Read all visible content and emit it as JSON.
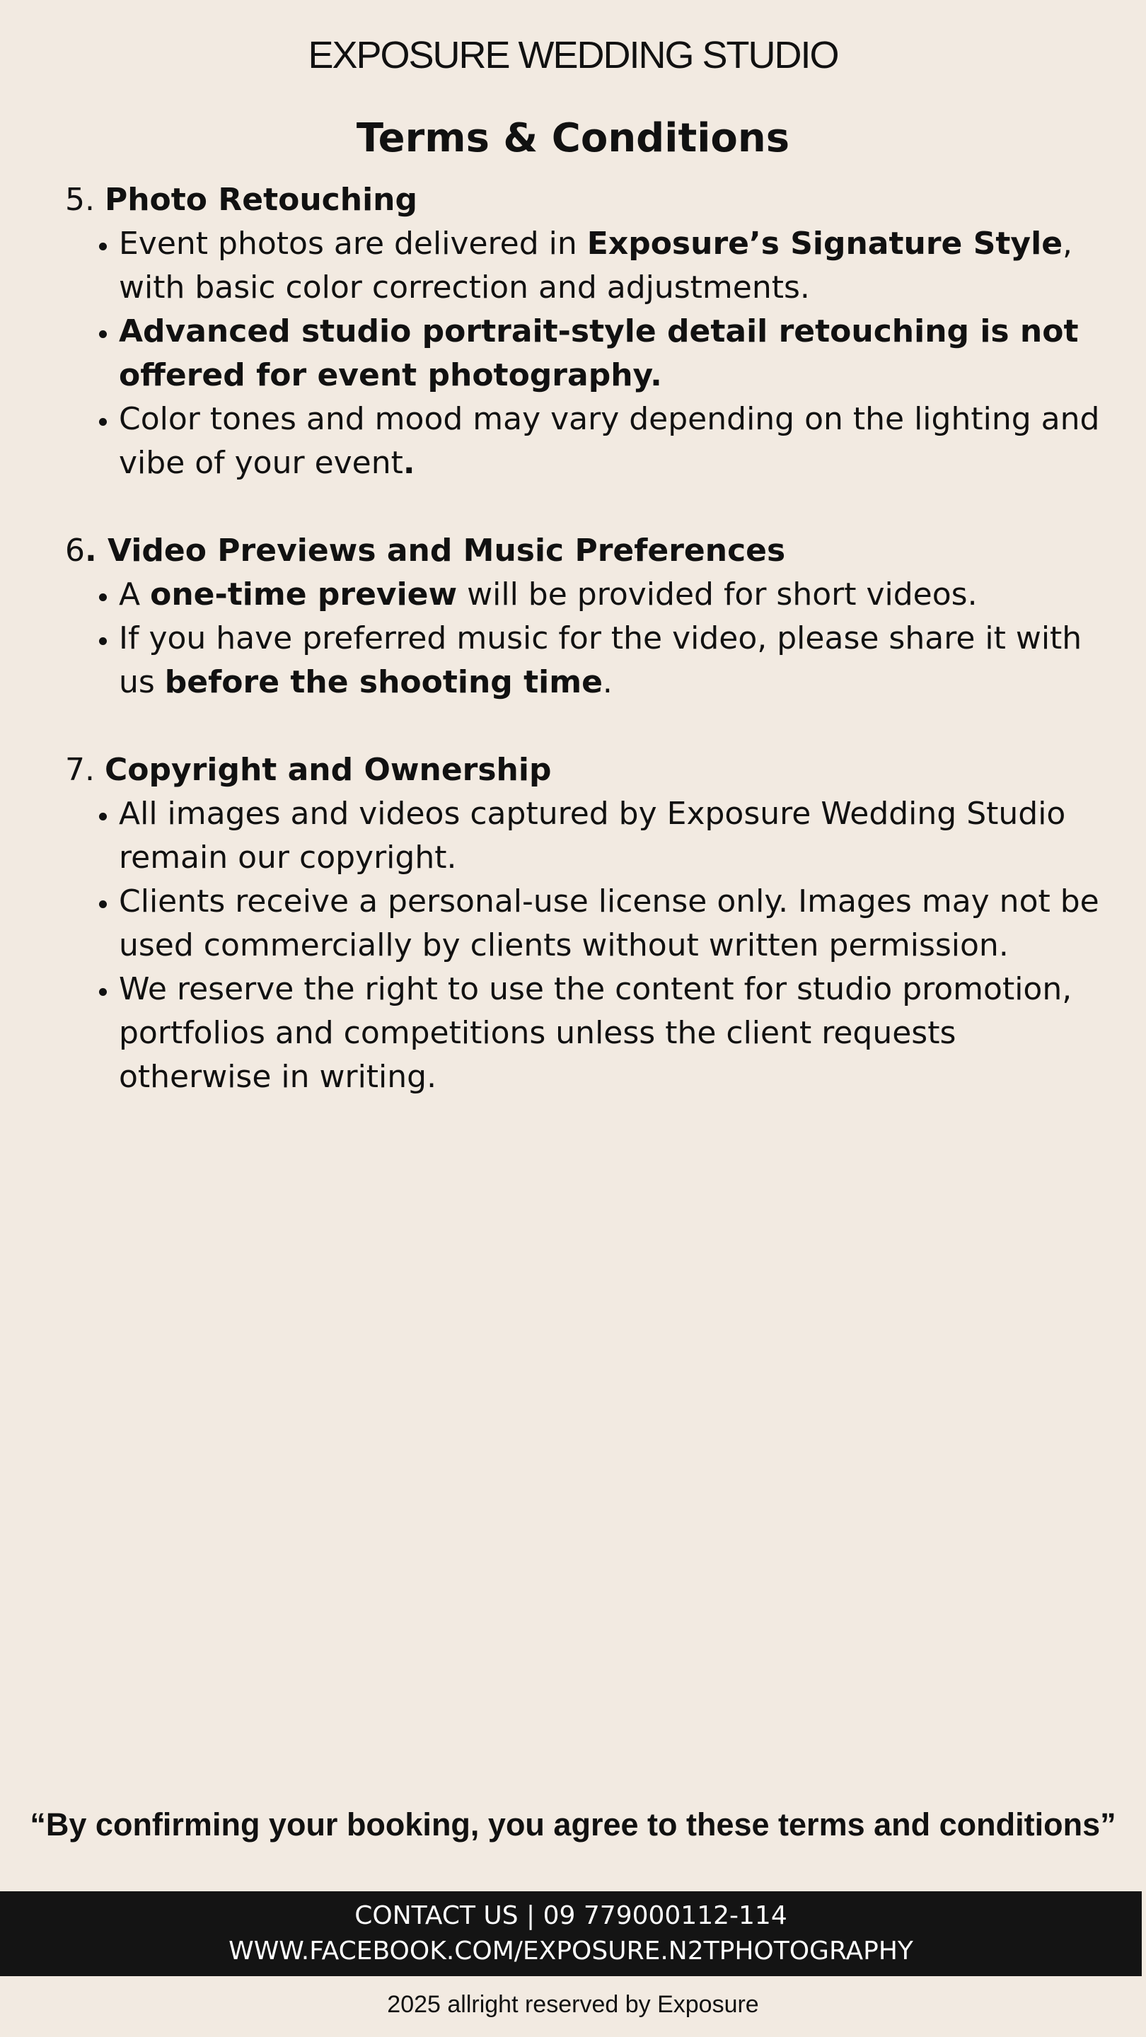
{
  "brand": "EXPOSURE WEDDING STUDIO",
  "title": "Terms & Conditions",
  "sections": [
    {
      "number": "5. ",
      "heading": "Photo Retouching",
      "bullets": [
        {
          "parts": [
            {
              "t": "Event photos are delivered in ",
              "b": false
            },
            {
              "t": "Exposure’s Signature Style",
              "b": true
            },
            {
              "t": ", with basic color correction and adjustments.",
              "b": false
            }
          ]
        },
        {
          "parts": [
            {
              "t": "Advanced  studio portrait-style detail retouching is not offered for event photography.",
              "b": true
            }
          ]
        },
        {
          "parts": [
            {
              "t": "Color tones and mood may vary depending on the lighting and vibe of your event",
              "b": false
            },
            {
              "t": ".",
              "b": true
            }
          ]
        }
      ]
    },
    {
      "number": "6",
      "heading": ". Video Previews and Music Preferences",
      "bullets": [
        {
          "parts": [
            {
              "t": "A ",
              "b": false
            },
            {
              "t": "one-time preview",
              "b": true
            },
            {
              "t": " will be provided for short videos.",
              "b": false
            }
          ]
        },
        {
          "parts": [
            {
              "t": "If you have preferred music for the video, please share it with us ",
              "b": false
            },
            {
              "t": "before the shooting time",
              "b": true
            },
            {
              "t": ".",
              "b": false
            }
          ]
        }
      ]
    },
    {
      "number": "7. ",
      "heading": "Copyright and Ownership",
      "bullets": [
        {
          "parts": [
            {
              "t": "All images and videos captured by Exposure Wedding Studio remain our copyright.",
              "b": false
            }
          ]
        },
        {
          "parts": [
            {
              "t": "Clients receive a personal-use license only. Images may not be used commercially by clients without written permission.",
              "b": false
            }
          ]
        },
        {
          "parts": [
            {
              "t": "We reserve the right to use the content for studio promotion, portfolios and competitions unless the client requests otherwise in writing.",
              "b": false
            }
          ]
        }
      ]
    }
  ],
  "quote": "“By confirming your booking, you agree to these terms and conditions”",
  "contact": {
    "line1": "CONTACT US | 09 779000112-114",
    "line2": "WWW.FACEBOOK.COM/EXPOSURE.N2TPHOTOGRAPHY"
  },
  "footer": "2025 allright reserved by Exposure"
}
